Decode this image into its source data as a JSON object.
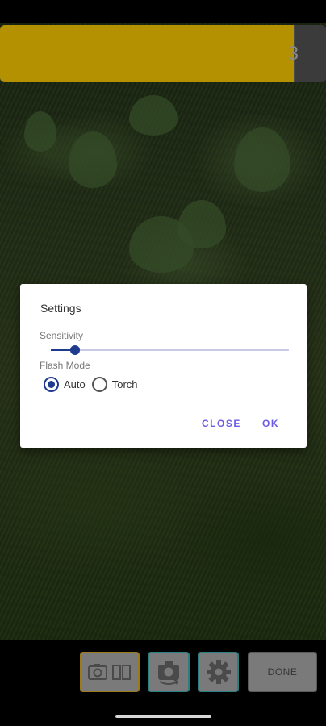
{
  "progress": {
    "value_text": "3",
    "fill_fraction": 0.9,
    "fill_color": "#b39100",
    "track_color": "#4b4b4b"
  },
  "dialog": {
    "title": "Settings",
    "sensitivity": {
      "label": "Sensitivity",
      "value_fraction": 0.1,
      "accent_color": "#1f3b8f"
    },
    "flash_mode": {
      "label": "Flash Mode",
      "options": [
        {
          "label": "Auto",
          "selected": true
        },
        {
          "label": "Torch",
          "selected": false
        }
      ]
    },
    "buttons": {
      "close": "CLOSE",
      "ok": "OK"
    },
    "button_color": "#6c5ce7"
  },
  "toolbar": {
    "camera_button_icon": "camera-icon",
    "split_icon": "split-view-icon",
    "swap_button_icon": "camera-switch-icon",
    "settings_button_icon": "gear-icon",
    "done_label": "DONE"
  }
}
